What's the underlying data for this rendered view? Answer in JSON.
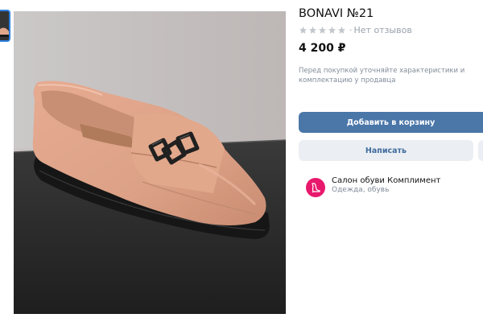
{
  "product": {
    "title": "BONAVI №21",
    "rating": {
      "stars_filled": 0,
      "stars_total": 5,
      "separator": "·",
      "reviews_text": "Нет отзывов"
    },
    "price": "4 200 ₽",
    "note": "Перед покупкой уточняйте характеристики и комплектацию у продавца"
  },
  "actions": {
    "add_to_cart_label": "Добавить в корзину",
    "message_label": "Написать"
  },
  "seller": {
    "name": "Салон обуви Комплимент",
    "category": "Одежда, обувь"
  },
  "colors": {
    "primary_button": "#4a76a8",
    "secondary_button": "#ebeef2",
    "secondary_text": "#3f6b9e",
    "muted_text": "#818c99",
    "star_empty": "#c4c8cc",
    "seller_avatar": "#e8196d"
  },
  "icons": {
    "star": "star-outline",
    "seller_logo": "shoe-logo"
  }
}
